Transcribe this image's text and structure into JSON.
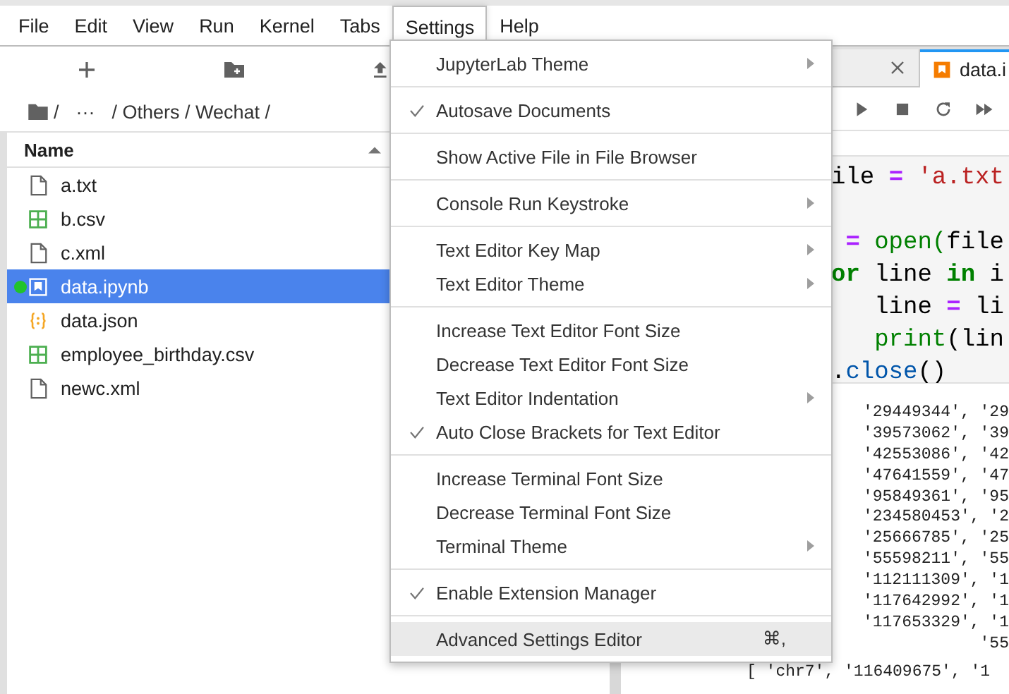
{
  "menubar": [
    {
      "label": "File",
      "selected": false
    },
    {
      "label": "Edit",
      "selected": false
    },
    {
      "label": "View",
      "selected": false
    },
    {
      "label": "Run",
      "selected": false
    },
    {
      "label": "Kernel",
      "selected": false
    },
    {
      "label": "Tabs",
      "selected": false
    },
    {
      "label": "Settings",
      "selected": true
    },
    {
      "label": "Help",
      "selected": false
    }
  ],
  "file_browser": {
    "breadcrumb": {
      "separator": "/",
      "collapsed": "···",
      "trail": "/ Others / Wechat /"
    },
    "column": "Name",
    "files": [
      {
        "name": "a.txt",
        "kind": "text",
        "selected": false,
        "running": false
      },
      {
        "name": "b.csv",
        "kind": "csv",
        "selected": false,
        "running": false
      },
      {
        "name": "c.xml",
        "kind": "text",
        "selected": false,
        "running": false
      },
      {
        "name": "data.ipynb",
        "kind": "notebook",
        "selected": true,
        "running": true
      },
      {
        "name": "data.json",
        "kind": "json",
        "selected": false,
        "running": false
      },
      {
        "name": "employee_birthday.csv",
        "kind": "csv",
        "selected": false,
        "running": false
      },
      {
        "name": "newc.xml",
        "kind": "text",
        "selected": false,
        "running": false
      }
    ]
  },
  "tabs": [
    {
      "selected": false
    },
    {
      "label": "data.i",
      "selected": true
    }
  ],
  "code": {
    "lines": [
      {
        "kind": "code",
        "tokens": [
          {
            "text": "ile ",
            "kind": "plain"
          },
          {
            "text": "=",
            "kind": "op"
          },
          {
            "text": " 'a.txt",
            "kind": "string"
          }
        ]
      },
      {
        "kind": "blank"
      },
      {
        "kind": "code",
        "tokens": [
          {
            "text": " =",
            "kind": "op"
          },
          {
            "text": " open(",
            "kind": "builtin"
          },
          {
            "text": "file",
            "kind": "plain"
          }
        ]
      },
      {
        "kind": "code",
        "tokens": [
          {
            "text": "or",
            "kind": "keyword"
          },
          {
            "text": " line ",
            "kind": "plain"
          },
          {
            "text": "in",
            "kind": "keyword"
          },
          {
            "text": " i",
            "kind": "plain"
          }
        ]
      },
      {
        "kind": "code",
        "tokens": [
          {
            "text": "   line ",
            "kind": "plain"
          },
          {
            "text": "=",
            "kind": "op"
          },
          {
            "text": " li",
            "kind": "plain"
          }
        ]
      },
      {
        "kind": "code",
        "tokens": [
          {
            "text": "   print",
            "kind": "builtin"
          },
          {
            "text": "(lin",
            "kind": "plain"
          }
        ]
      },
      {
        "kind": "code",
        "tokens": [
          {
            "text": ".",
            "kind": "plain"
          },
          {
            "text": "close",
            "kind": "property"
          },
          {
            "text": "()",
            "kind": "plain"
          }
        ]
      }
    ]
  },
  "output": {
    "lines": [
      "'29449344', '29",
      "'39573062', '39",
      "'42553086', '42",
      "'47641559', '47",
      "'95849361', '95",
      "'234580453', '2",
      "'25666785', '25",
      "'55598211', '55",
      "'112111309', '1",
      "'117642992', '1",
      "'117653329', '1",
      "'55"
    ],
    "last_line": "[ 'chr7', '116409675', '1"
  },
  "settings_menu": {
    "groups": [
      [
        {
          "label": "JupyterLab Theme",
          "checked": false,
          "submenu": true,
          "highlighted": false
        }
      ],
      [
        {
          "label": "Autosave Documents",
          "checked": true,
          "submenu": false,
          "highlighted": false
        }
      ],
      [
        {
          "label": "Show Active File in File Browser",
          "checked": false,
          "submenu": false,
          "highlighted": false
        }
      ],
      [
        {
          "label": "Console Run Keystroke",
          "checked": false,
          "submenu": true,
          "highlighted": false
        }
      ],
      [
        {
          "label": "Text Editor Key Map",
          "checked": false,
          "submenu": true,
          "highlighted": false
        },
        {
          "label": "Text Editor Theme",
          "checked": false,
          "submenu": true,
          "highlighted": false
        }
      ],
      [
        {
          "label": "Increase Text Editor Font Size",
          "checked": false,
          "submenu": false,
          "highlighted": false
        },
        {
          "label": "Decrease Text Editor Font Size",
          "checked": false,
          "submenu": false,
          "highlighted": false
        },
        {
          "label": "Text Editor Indentation",
          "checked": false,
          "submenu": true,
          "highlighted": false
        },
        {
          "label": "Auto Close Brackets for Text Editor",
          "checked": true,
          "submenu": false,
          "highlighted": false
        }
      ],
      [
        {
          "label": "Increase Terminal Font Size",
          "checked": false,
          "submenu": false,
          "highlighted": false
        },
        {
          "label": "Decrease Terminal Font Size",
          "checked": false,
          "submenu": false,
          "highlighted": false
        },
        {
          "label": "Terminal Theme",
          "checked": false,
          "submenu": true,
          "highlighted": false
        }
      ],
      [
        {
          "label": "Enable Extension Manager",
          "checked": true,
          "submenu": false,
          "highlighted": false
        }
      ],
      [
        {
          "label": "Advanced Settings Editor",
          "checked": false,
          "submenu": false,
          "highlighted": true,
          "shortcut": "⌘,"
        }
      ]
    ]
  }
}
